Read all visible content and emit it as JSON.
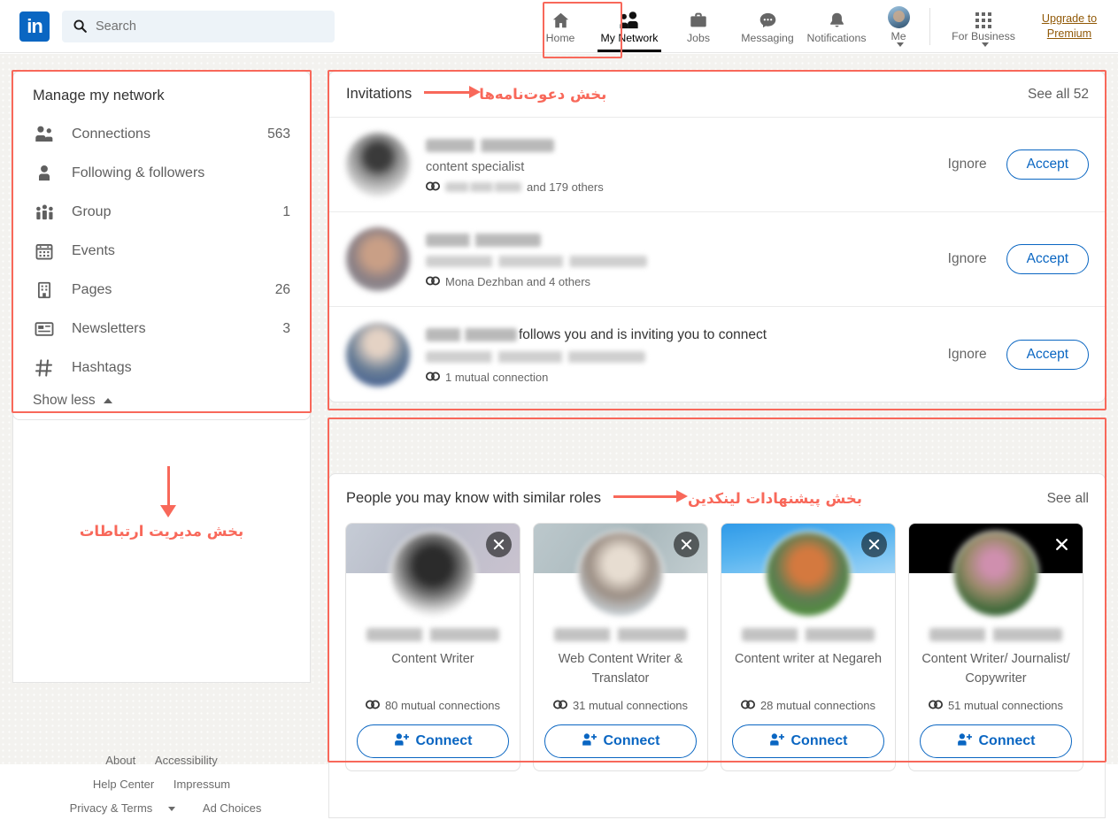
{
  "nav": {
    "logo": "in",
    "search": {
      "placeholder": "Search",
      "value": ""
    },
    "items": [
      {
        "label": "Home",
        "icon": "home-icon",
        "active": false
      },
      {
        "label": "My Network",
        "icon": "my-network-icon",
        "active": true
      },
      {
        "label": "Jobs",
        "icon": "jobs-icon",
        "active": false
      },
      {
        "label": "Messaging",
        "icon": "messaging-icon",
        "active": false
      },
      {
        "label": "Notifications",
        "icon": "notifications-icon",
        "active": false
      }
    ],
    "me": {
      "label": "Me",
      "icon": "avatar"
    },
    "for_business": {
      "label": "For Business",
      "icon": "grid-icon"
    },
    "upgrade": {
      "line1": "Upgrade to",
      "line2": "Premium",
      "color": "#915907"
    }
  },
  "sidebar": {
    "title": "Manage my network",
    "items": [
      {
        "label": "Connections",
        "count": "563",
        "icon": "connections-icon"
      },
      {
        "label": "Following & followers",
        "count": "",
        "icon": "following-icon"
      },
      {
        "label": "Group",
        "count": "1",
        "icon": "group-icon"
      },
      {
        "label": "Events",
        "count": "",
        "icon": "events-icon"
      },
      {
        "label": "Pages",
        "count": "26",
        "icon": "pages-icon"
      },
      {
        "label": "Newsletters",
        "count": "3",
        "icon": "newsletters-icon"
      },
      {
        "label": "Hashtags",
        "count": "",
        "icon": "hashtags-icon"
      }
    ],
    "show_less": "Show less"
  },
  "annotations": {
    "invitations_fa": "بخش دعوت‌نامه‌ها",
    "pymk_fa": "بخش پیشنهادات لینکدین",
    "manage_network_fa": "بخش مدیریت ارتباطات",
    "color": "#f8685a"
  },
  "invitations": {
    "title": "Invitations",
    "see_all": "See all 52",
    "rows": [
      {
        "name_blurred": true,
        "name_width": 145,
        "subtitle": "content specialist",
        "subtitle_blurred": false,
        "mutual": "and 179 others",
        "mutual_has_blurred_name": true,
        "mutual_blur_width": 86,
        "ignore": "Ignore",
        "accept": "Accept"
      },
      {
        "name_blurred": true,
        "name_width": 130,
        "subtitle": "",
        "subtitle_blurred": true,
        "subtitle_width": 250,
        "mutual": "Mona Dezhban and 4 others",
        "mutual_has_blurred_name": false,
        "ignore": "Ignore",
        "accept": "Accept"
      },
      {
        "name_blurred": true,
        "name_width": 103,
        "trailing_text": "follows you and is inviting you to connect",
        "subtitle": "",
        "subtitle_blurred": true,
        "subtitle_width": 248,
        "mutual": "1 mutual connection",
        "mutual_has_blurred_name": false,
        "ignore": "Ignore",
        "accept": "Accept"
      }
    ]
  },
  "pymk": {
    "title": "People you may know with similar roles",
    "see_all": "See all",
    "cards": [
      {
        "name_blurred": true,
        "role": "Content Writer",
        "mutual": "80 mutual connections",
        "connect": "Connect",
        "cover": "cov1",
        "avatar": "pav1",
        "close_on_black": false
      },
      {
        "name_blurred": true,
        "role": "Web Content Writer & Translator",
        "mutual": "31 mutual connections",
        "connect": "Connect",
        "cover": "cov2",
        "avatar": "pav2",
        "close_on_black": false
      },
      {
        "name_blurred": true,
        "role": "Content writer at Negareh",
        "mutual": "28 mutual connections",
        "connect": "Connect",
        "cover": "cov3",
        "avatar": "pav3",
        "close_on_black": false
      },
      {
        "name_blurred": true,
        "role": "Content Writer/ Journalist/ Copywriter",
        "mutual": "51 mutual connections",
        "connect": "Connect",
        "cover": "cov4",
        "avatar": "pav4",
        "close_on_black": true
      }
    ]
  },
  "footer": {
    "row1": [
      "About",
      "Accessibility"
    ],
    "row2": [
      "Help Center",
      "Impressum"
    ],
    "row3": [
      "Privacy & Terms",
      "Ad Choices"
    ]
  }
}
